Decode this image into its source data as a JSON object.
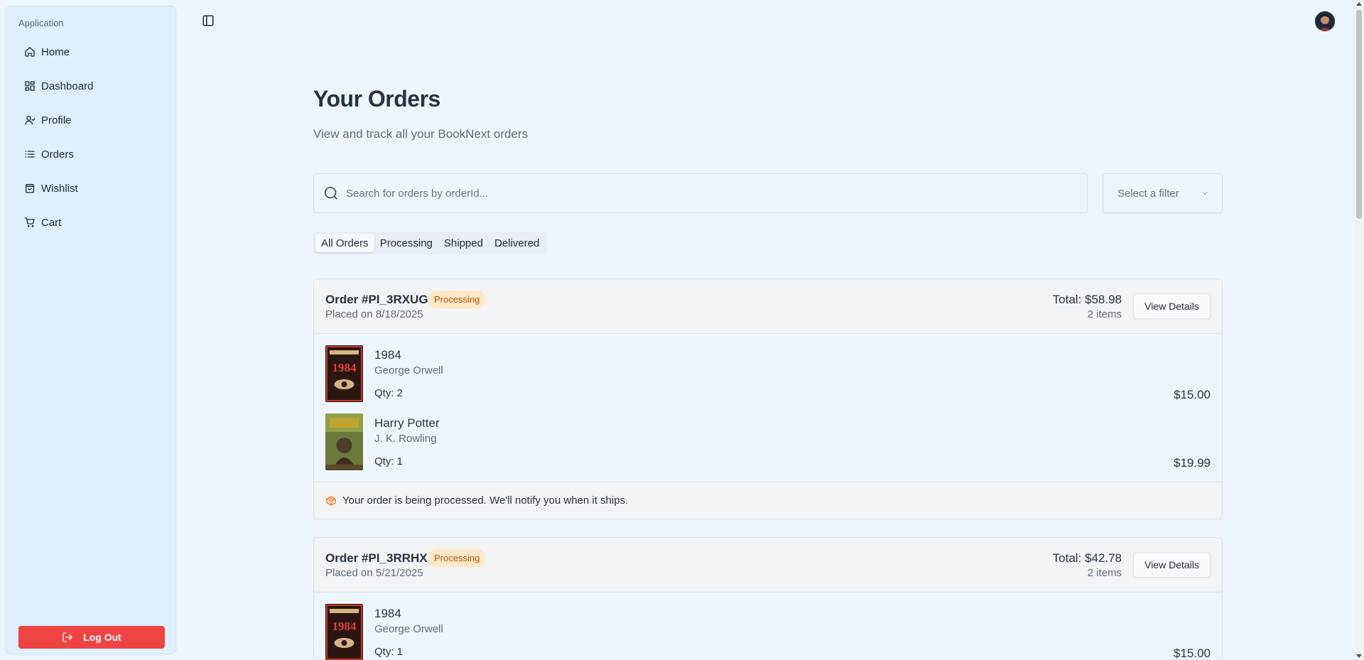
{
  "sidebar": {
    "group_label": "Application",
    "items": [
      {
        "label": "Home",
        "icon": "home-icon"
      },
      {
        "label": "Dashboard",
        "icon": "dashboard-icon"
      },
      {
        "label": "Profile",
        "icon": "user-icon"
      },
      {
        "label": "Orders",
        "icon": "list-icon"
      },
      {
        "label": "Wishlist",
        "icon": "bag-icon"
      },
      {
        "label": "Cart",
        "icon": "cart-icon"
      }
    ],
    "logout_label": "Log Out"
  },
  "header": {
    "title": "Your Orders",
    "subtitle": "View and track all your BookNext orders"
  },
  "search": {
    "placeholder": "Search for orders by orderId...",
    "value": ""
  },
  "filter": {
    "placeholder": "Select a filter"
  },
  "tabs": [
    {
      "label": "All Orders",
      "active": true
    },
    {
      "label": "Processing",
      "active": false
    },
    {
      "label": "Shipped",
      "active": false
    },
    {
      "label": "Delivered",
      "active": false
    }
  ],
  "orders": [
    {
      "id": "Order #PI_3RXUG",
      "status": "Processing",
      "placed": "Placed on 8/18/2025",
      "total": "Total: $58.98",
      "count": "2 items",
      "action": "View Details",
      "items": [
        {
          "title": "1984",
          "author": "George Orwell",
          "qty": "Qty: 2",
          "price": "$15.00"
        },
        {
          "title": "Harry Potter",
          "author": "J. K. Rowling",
          "qty": "Qty: 1",
          "price": "$19.99"
        }
      ],
      "note": "Your order is being processed. We'll notify you when it ships."
    },
    {
      "id": "Order #PI_3RRHX",
      "status": "Processing",
      "placed": "Placed on 5/21/2025",
      "total": "Total: $42.78",
      "count": "2 items",
      "action": "View Details",
      "items": [
        {
          "title": "1984",
          "author": "George Orwell",
          "qty": "Qty: 1",
          "price": "$15.00"
        }
      ]
    }
  ],
  "colors": {
    "background": "#eef6fd",
    "sidebar": "#dfeffb",
    "logout": "#ef4444",
    "badge_bg": "#fde8c8",
    "badge_text": "#b45309",
    "note_icon": "#f97316"
  }
}
